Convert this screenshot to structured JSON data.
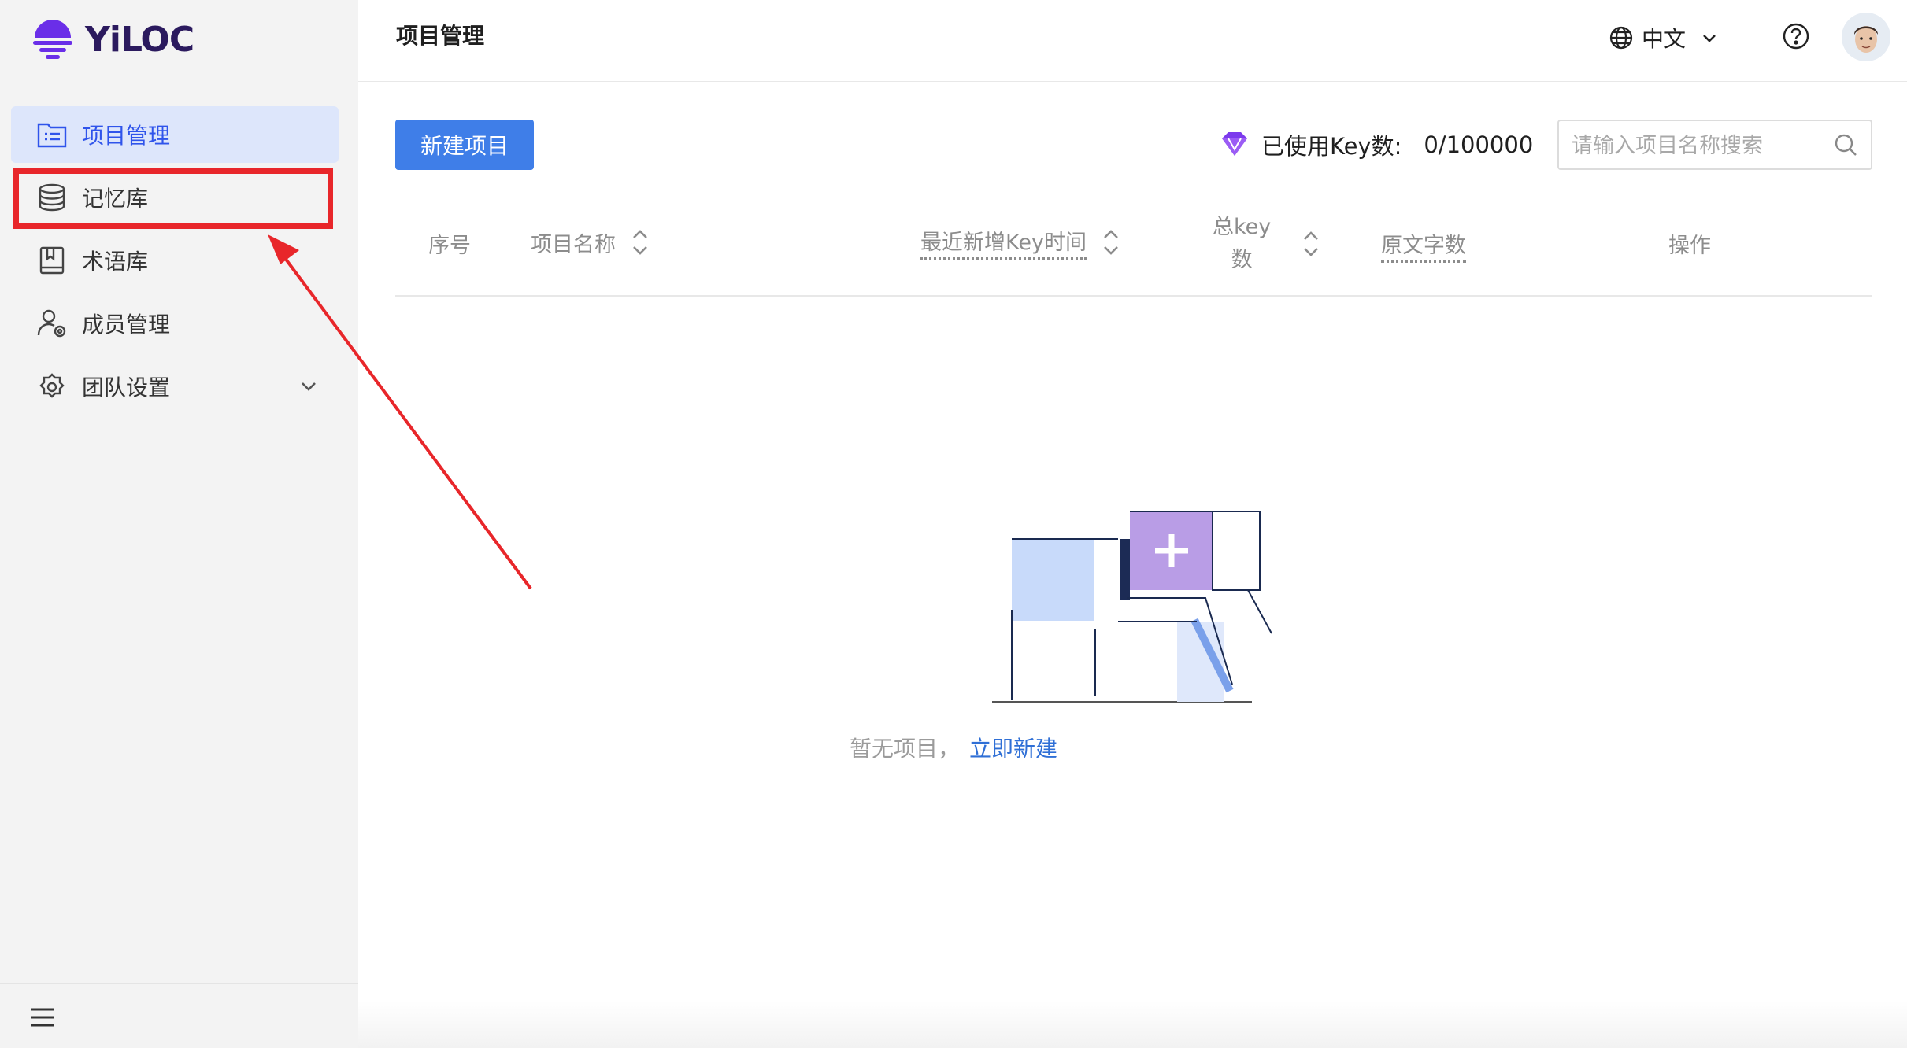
{
  "app": {
    "logo_text": "YiLOC"
  },
  "sidebar": {
    "items": [
      {
        "label": "项目管理",
        "icon": "folder-list-icon",
        "active": true
      },
      {
        "label": "记忆库",
        "icon": "database-icon",
        "active": false
      },
      {
        "label": "术语库",
        "icon": "book-icon",
        "active": false
      },
      {
        "label": "成员管理",
        "icon": "user-settings-icon",
        "active": false
      },
      {
        "label": "团队设置",
        "icon": "gear-icon",
        "active": false
      }
    ]
  },
  "header": {
    "title": "项目管理",
    "language": "中文"
  },
  "toolbar": {
    "new_project_label": "新建项目",
    "key_usage_label": "已使用Key数:",
    "key_usage_value": "0/100000",
    "search_placeholder": "请输入项目名称搜索"
  },
  "table": {
    "columns": {
      "index": "序号",
      "name": "项目名称",
      "recent_key_time": "最近新增Key时间",
      "total_key_line1": "总key",
      "total_key_line2": "数",
      "source_chars": "原文字数",
      "actions": "操作"
    }
  },
  "empty_state": {
    "text": "暂无项目，",
    "link": "立即新建"
  },
  "colors": {
    "primary": "#3f7ee8",
    "active_bg": "#dde6fb",
    "highlight_red": "#e8262a",
    "logo_purple": "#6a2ee8"
  }
}
